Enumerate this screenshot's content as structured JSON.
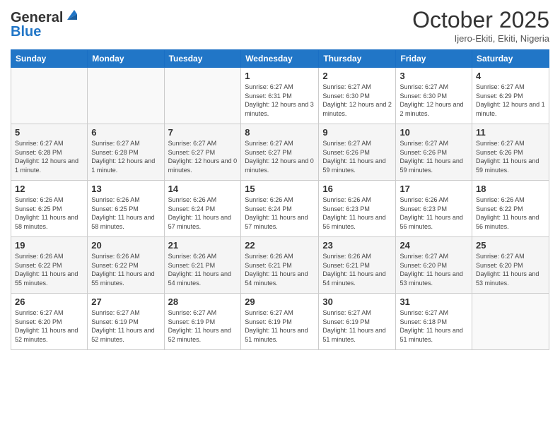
{
  "header": {
    "logo_line1": "General",
    "logo_line2": "Blue",
    "month": "October 2025",
    "location": "Ijero-Ekiti, Ekiti, Nigeria"
  },
  "days_of_week": [
    "Sunday",
    "Monday",
    "Tuesday",
    "Wednesday",
    "Thursday",
    "Friday",
    "Saturday"
  ],
  "weeks": [
    [
      {
        "day": "",
        "info": ""
      },
      {
        "day": "",
        "info": ""
      },
      {
        "day": "",
        "info": ""
      },
      {
        "day": "1",
        "info": "Sunrise: 6:27 AM\nSunset: 6:31 PM\nDaylight: 12 hours and 3 minutes."
      },
      {
        "day": "2",
        "info": "Sunrise: 6:27 AM\nSunset: 6:30 PM\nDaylight: 12 hours and 2 minutes."
      },
      {
        "day": "3",
        "info": "Sunrise: 6:27 AM\nSunset: 6:30 PM\nDaylight: 12 hours and 2 minutes."
      },
      {
        "day": "4",
        "info": "Sunrise: 6:27 AM\nSunset: 6:29 PM\nDaylight: 12 hours and 1 minute."
      }
    ],
    [
      {
        "day": "5",
        "info": "Sunrise: 6:27 AM\nSunset: 6:28 PM\nDaylight: 12 hours and 1 minute."
      },
      {
        "day": "6",
        "info": "Sunrise: 6:27 AM\nSunset: 6:28 PM\nDaylight: 12 hours and 1 minute."
      },
      {
        "day": "7",
        "info": "Sunrise: 6:27 AM\nSunset: 6:27 PM\nDaylight: 12 hours and 0 minutes."
      },
      {
        "day": "8",
        "info": "Sunrise: 6:27 AM\nSunset: 6:27 PM\nDaylight: 12 hours and 0 minutes."
      },
      {
        "day": "9",
        "info": "Sunrise: 6:27 AM\nSunset: 6:26 PM\nDaylight: 11 hours and 59 minutes."
      },
      {
        "day": "10",
        "info": "Sunrise: 6:27 AM\nSunset: 6:26 PM\nDaylight: 11 hours and 59 minutes."
      },
      {
        "day": "11",
        "info": "Sunrise: 6:27 AM\nSunset: 6:26 PM\nDaylight: 11 hours and 59 minutes."
      }
    ],
    [
      {
        "day": "12",
        "info": "Sunrise: 6:26 AM\nSunset: 6:25 PM\nDaylight: 11 hours and 58 minutes."
      },
      {
        "day": "13",
        "info": "Sunrise: 6:26 AM\nSunset: 6:25 PM\nDaylight: 11 hours and 58 minutes."
      },
      {
        "day": "14",
        "info": "Sunrise: 6:26 AM\nSunset: 6:24 PM\nDaylight: 11 hours and 57 minutes."
      },
      {
        "day": "15",
        "info": "Sunrise: 6:26 AM\nSunset: 6:24 PM\nDaylight: 11 hours and 57 minutes."
      },
      {
        "day": "16",
        "info": "Sunrise: 6:26 AM\nSunset: 6:23 PM\nDaylight: 11 hours and 56 minutes."
      },
      {
        "day": "17",
        "info": "Sunrise: 6:26 AM\nSunset: 6:23 PM\nDaylight: 11 hours and 56 minutes."
      },
      {
        "day": "18",
        "info": "Sunrise: 6:26 AM\nSunset: 6:22 PM\nDaylight: 11 hours and 56 minutes."
      }
    ],
    [
      {
        "day": "19",
        "info": "Sunrise: 6:26 AM\nSunset: 6:22 PM\nDaylight: 11 hours and 55 minutes."
      },
      {
        "day": "20",
        "info": "Sunrise: 6:26 AM\nSunset: 6:22 PM\nDaylight: 11 hours and 55 minutes."
      },
      {
        "day": "21",
        "info": "Sunrise: 6:26 AM\nSunset: 6:21 PM\nDaylight: 11 hours and 54 minutes."
      },
      {
        "day": "22",
        "info": "Sunrise: 6:26 AM\nSunset: 6:21 PM\nDaylight: 11 hours and 54 minutes."
      },
      {
        "day": "23",
        "info": "Sunrise: 6:26 AM\nSunset: 6:21 PM\nDaylight: 11 hours and 54 minutes."
      },
      {
        "day": "24",
        "info": "Sunrise: 6:27 AM\nSunset: 6:20 PM\nDaylight: 11 hours and 53 minutes."
      },
      {
        "day": "25",
        "info": "Sunrise: 6:27 AM\nSunset: 6:20 PM\nDaylight: 11 hours and 53 minutes."
      }
    ],
    [
      {
        "day": "26",
        "info": "Sunrise: 6:27 AM\nSunset: 6:20 PM\nDaylight: 11 hours and 52 minutes."
      },
      {
        "day": "27",
        "info": "Sunrise: 6:27 AM\nSunset: 6:19 PM\nDaylight: 11 hours and 52 minutes."
      },
      {
        "day": "28",
        "info": "Sunrise: 6:27 AM\nSunset: 6:19 PM\nDaylight: 11 hours and 52 minutes."
      },
      {
        "day": "29",
        "info": "Sunrise: 6:27 AM\nSunset: 6:19 PM\nDaylight: 11 hours and 51 minutes."
      },
      {
        "day": "30",
        "info": "Sunrise: 6:27 AM\nSunset: 6:19 PM\nDaylight: 11 hours and 51 minutes."
      },
      {
        "day": "31",
        "info": "Sunrise: 6:27 AM\nSunset: 6:18 PM\nDaylight: 11 hours and 51 minutes."
      },
      {
        "day": "",
        "info": ""
      }
    ]
  ]
}
